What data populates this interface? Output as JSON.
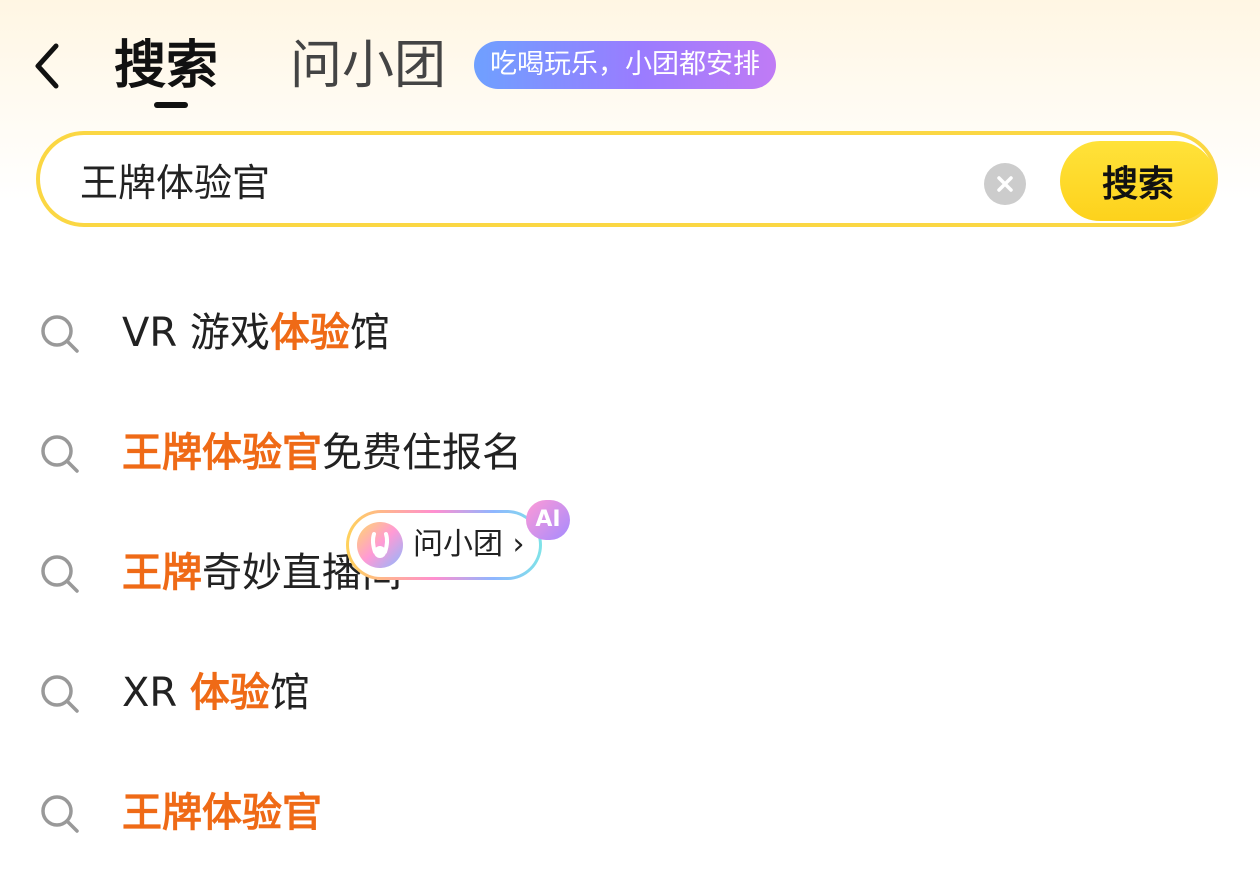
{
  "header": {
    "tabs": [
      {
        "label": "搜索",
        "active": true
      },
      {
        "label": "问小团",
        "active": false
      }
    ],
    "badge_text": "吃喝玩乐，小团都安排"
  },
  "search": {
    "value": "王牌体验官",
    "button_label": "搜索"
  },
  "suggestions": [
    {
      "parts": [
        {
          "text": "VR 游戏",
          "highlight": false
        },
        {
          "text": "体验",
          "highlight": true
        },
        {
          "text": "馆",
          "highlight": false
        }
      ]
    },
    {
      "parts": [
        {
          "text": "王牌体验官",
          "highlight": true
        },
        {
          "text": "免费住报名",
          "highlight": false
        }
      ]
    },
    {
      "parts": [
        {
          "text": "王牌",
          "highlight": true
        },
        {
          "text": "奇妙直播间",
          "highlight": false
        }
      ]
    },
    {
      "parts": [
        {
          "text": "XR ",
          "highlight": false
        },
        {
          "text": "体验",
          "highlight": true
        },
        {
          "text": "馆",
          "highlight": false
        }
      ]
    },
    {
      "parts": [
        {
          "text": "王牌体验官",
          "highlight": true
        }
      ]
    }
  ],
  "ask_chip": {
    "label": "问小团 ›",
    "ai_badge": "AI"
  },
  "colors": {
    "highlight": "#ef6a16",
    "accent_yellow": "#fdd21c",
    "search_border": "#fbd743"
  }
}
